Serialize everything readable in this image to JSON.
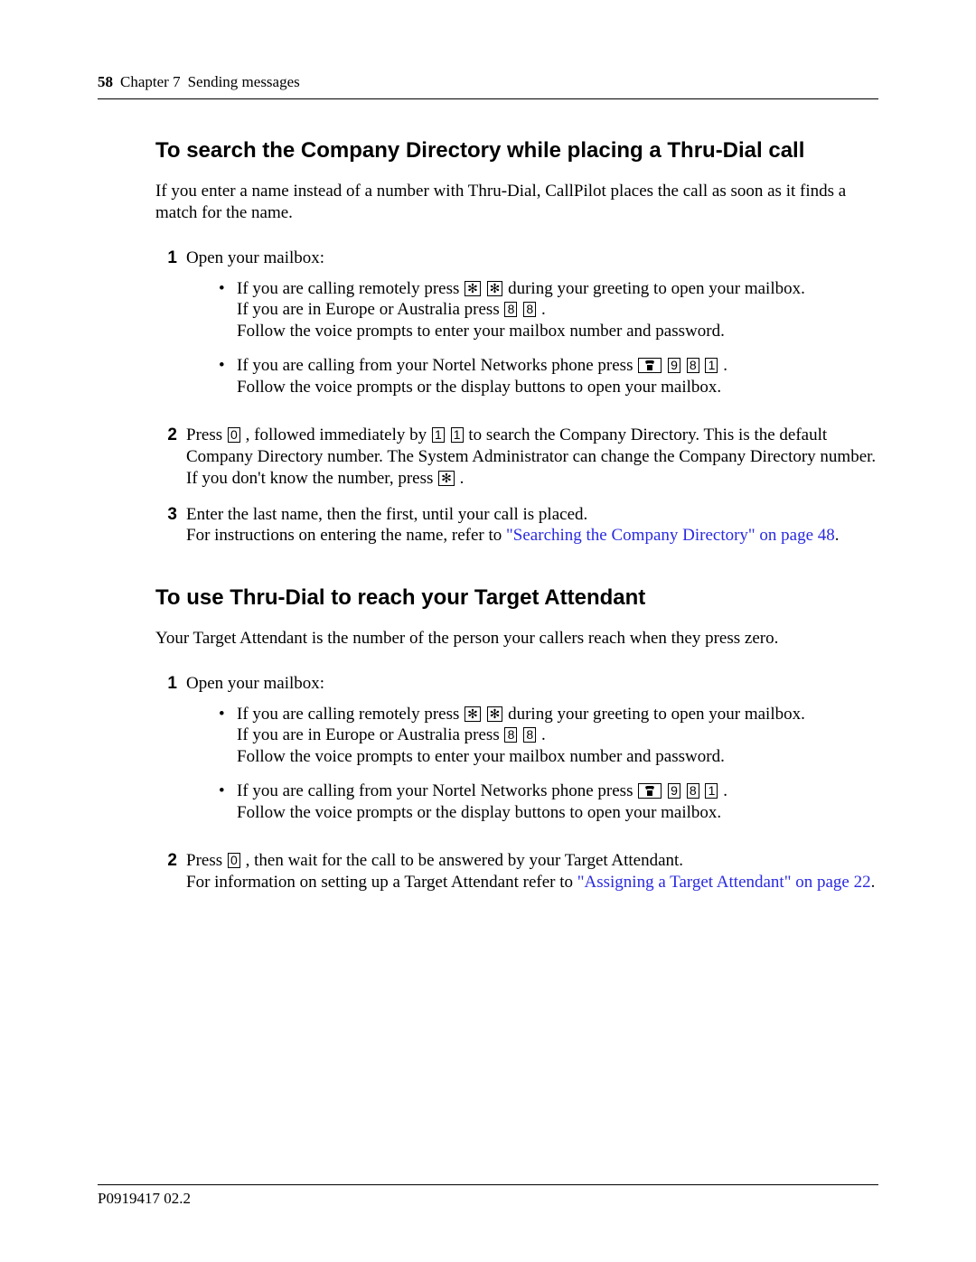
{
  "header": {
    "page_number": "58",
    "chapter_label": "Chapter 7",
    "chapter_title": "Sending messages"
  },
  "section1": {
    "heading": "To search the Company Directory while placing a Thru-Dial call",
    "intro": "If you enter a name instead of a number with Thru-Dial, CallPilot places the call as soon as it finds a match for the name.",
    "step1": {
      "num": "1",
      "lead": "Open your mailbox:",
      "b1_a": "If you are calling remotely press ",
      "b1_b": " during your greeting to open your mailbox.",
      "b1_c": "If you are in Europe or Australia press ",
      "b1_d": ".",
      "b1_e": "Follow the voice prompts to enter your mailbox number and password.",
      "b2_a": "If you are calling from your Nortel Networks phone press ",
      "b2_b": ".",
      "b2_c": "Follow the voice prompts or the display buttons to open your mailbox."
    },
    "step2": {
      "num": "2",
      "a": "Press ",
      "b": ", followed immediately by ",
      "c": " to search the Company Directory. This is the default Company Directory number. The System Administrator can change the Company Directory number. If you don't know the number, press ",
      "d": "."
    },
    "step3": {
      "num": "3",
      "a": "Enter the last name, then the first, until your call is placed.",
      "b": "For instructions on entering the name, refer to ",
      "link": "\"Searching the Company Directory\" on page 48",
      "c": "."
    }
  },
  "section2": {
    "heading": "To use Thru-Dial to reach your Target Attendant",
    "intro": "Your Target Attendant is the number of the person your callers reach when they press zero.",
    "step1": {
      "num": "1",
      "lead": "Open your mailbox:",
      "b1_a": "If you are calling remotely press ",
      "b1_b": " during your greeting to open your mailbox.",
      "b1_c": "If you are in Europe or Australia press ",
      "b1_d": ".",
      "b1_e": "Follow the voice prompts to enter your mailbox number and password.",
      "b2_a": "If you are calling from your Nortel Networks phone press ",
      "b2_b": ".",
      "b2_c": "Follow the voice prompts or the display buttons to open your mailbox."
    },
    "step2": {
      "num": "2",
      "a": "Press ",
      "b": ", then wait for the call to be answered by your Target Attendant.",
      "c": "For information on setting up a Target Attendant refer to ",
      "link": "\"Assigning a Target Attendant\" on page 22",
      "d": "."
    }
  },
  "keys": {
    "star": "✻",
    "eight": "8",
    "nine": "9",
    "one": "1",
    "zero": "0"
  },
  "footer": {
    "doc_number": "P0919417 02.2"
  }
}
